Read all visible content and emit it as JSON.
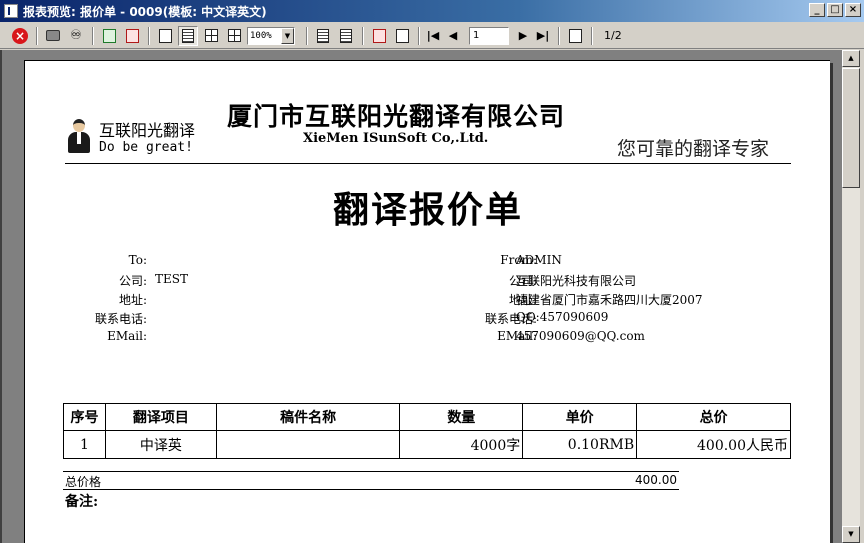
{
  "window": {
    "title": "报表预览: 报价单 - 0009(模板: 中文译英文)",
    "minimize": "_",
    "maximize": "□",
    "close": "×"
  },
  "toolbar": {
    "zoom": "100%",
    "page_input": "1",
    "page_count": "1/2",
    "icons": [
      "close-icon",
      "print-icon",
      "find-icon",
      "export-excel-icon",
      "export-pdf-icon",
      "single-page-icon",
      "page-width-icon",
      "multi-page-icon",
      "four-page-icon",
      "zoom-select",
      "layout-icon",
      "tree-icon",
      "delete-icon",
      "edit-icon",
      "first-page-icon",
      "prev-page-icon",
      "next-page-icon",
      "last-page-icon",
      "settings-icon"
    ]
  },
  "report": {
    "header": {
      "brand_cn": "互联阳光翻译",
      "motto": "Do be great!",
      "company_full": "厦门市互联阳光翻译有限公司",
      "company_en": "XieMen ISunSoft Co,.Ltd.",
      "slogan": "您可靠的翻译专家"
    },
    "title": "翻译报价单",
    "to": {
      "to_label": "To:",
      "to_value": "",
      "company_label": "公司:",
      "company_value": "TEST",
      "address_label": "地址:",
      "address_value": "",
      "phone_label": "联系电话:",
      "phone_value": "",
      "email_label": "EMail:",
      "email_value": ""
    },
    "from": {
      "from_label": "From:",
      "from_value": "ADMIN",
      "company_label": "公司:",
      "company_value": "互联阳光科技有限公司",
      "address_label": "地址:",
      "address_value": "福建省厦门市嘉禾路四川大厦2007",
      "phone_label": "联系电话:",
      "phone_value": "QQ:457090609",
      "email_label": "EMail:",
      "email_value": "457090609@QQ.com"
    },
    "table": {
      "headers": [
        "序号",
        "翻译项目",
        "稿件名称",
        "数量",
        "单价",
        "总价"
      ],
      "rows": [
        [
          "1",
          "中译英",
          "",
          "4000字",
          "0.10RMB",
          "400.00人民币"
        ]
      ]
    },
    "total_label": "总价格",
    "total_value": "400.00",
    "remark_label": "备注:"
  }
}
